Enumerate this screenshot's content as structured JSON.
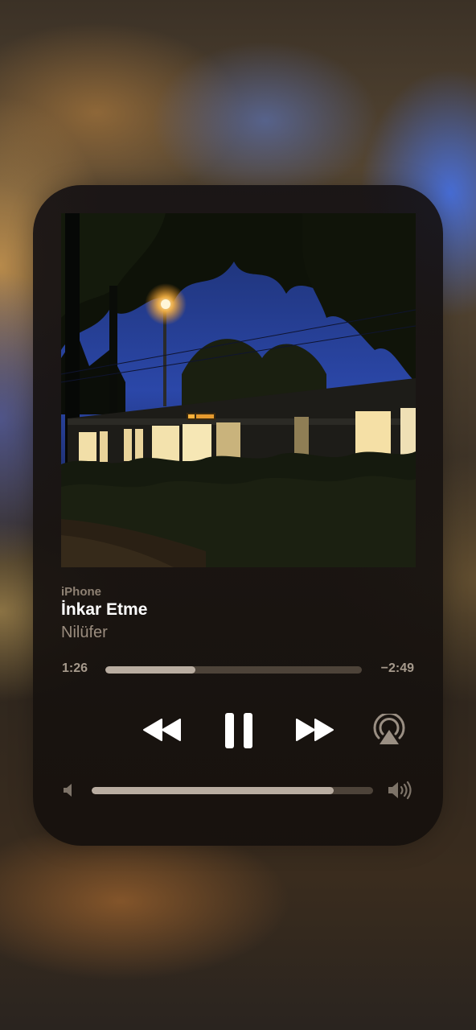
{
  "now_playing": {
    "source": "iPhone",
    "title": "İnkar Etme",
    "artist": "Nilüfer",
    "elapsed": "1:26",
    "remaining": "−2:49",
    "progress_fraction": 0.35,
    "volume_fraction": 0.86
  },
  "controls": {
    "rewind_icon": "rewind-icon",
    "pause_icon": "pause-icon",
    "forward_icon": "fast-forward-icon",
    "airplay_icon": "airplay-icon",
    "volume_low_icon": "speaker-low-icon",
    "volume_high_icon": "speaker-high-icon"
  },
  "colors": {
    "track": "#4d4339",
    "track_fill": "#b9ada1",
    "title": "#ffffff",
    "secondary_text": "#9a8c7e"
  }
}
